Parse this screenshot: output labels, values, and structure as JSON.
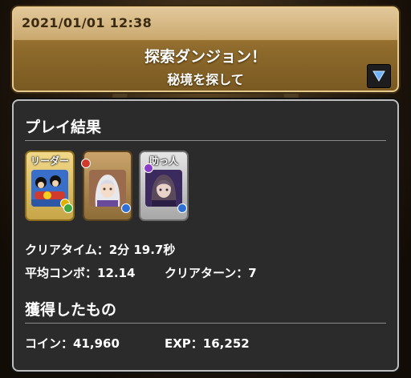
{
  "header": {
    "timestamp": "2021/01/01 12:38",
    "dungeon_name": "探索ダンジョン！",
    "dungeon_subtitle": "秘境を探して"
  },
  "result": {
    "title": "プレイ結果",
    "team": [
      {
        "label": "リーダー",
        "role": "leader",
        "icon": "leader-monster-portrait",
        "attributes": [
          "#e0b000",
          "#3ea63e"
        ]
      },
      {
        "label": "",
        "role": "member",
        "icon": "silver-haired-girl-portrait",
        "attributes": [
          "#d03a2a",
          "#2e6fd6"
        ]
      },
      {
        "label": "助っ人",
        "role": "helper",
        "icon": "dark-haired-girl-portrait",
        "attributes": [
          "#8a3ec8",
          "#2e6fd6"
        ]
      }
    ],
    "clear_time": "クリアタイム：2分 19.7秒",
    "avg_combo": "平均コンボ：12.14",
    "clear_turns": "クリアターン：7"
  },
  "rewards": {
    "title": "獲得したもの",
    "coins": "コイン：41,960",
    "exp": "EXP：16,252"
  },
  "colors": {
    "header_gold": "#b48a45",
    "panel_bg": "#2b2b2b",
    "text": "#ffffff"
  }
}
